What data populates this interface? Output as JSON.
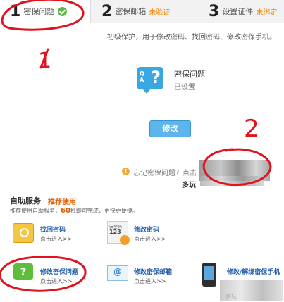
{
  "steps": [
    {
      "num": "1",
      "label": "密保问题",
      "status": ""
    },
    {
      "num": "2",
      "label": "密保邮箱",
      "status": "未验证"
    },
    {
      "num": "3",
      "label": "设置证件",
      "status": "未绑定"
    }
  ],
  "description": "初级保护，用于修改密码、找回密码、修改密保手机。",
  "question_card": {
    "title": "密保问题",
    "status": "已设置",
    "icon": "question-bubble-icon",
    "icon_text": "?"
  },
  "modify_button": "修改",
  "forgot_text": "忘记密保问题？点击",
  "more_text": "多玩",
  "self_service": {
    "title": "自助服务",
    "recommend": "推荐使用",
    "desc_prefix": "推荐使用自助服务，",
    "desc_seconds": "60",
    "desc_suffix": "秒即可完成，更快更便捷。"
  },
  "items": [
    {
      "title": "找回密码",
      "link": "点击进入>>",
      "icon": "folder-search-icon"
    },
    {
      "title": "修改密码",
      "link": "点击进入>>",
      "icon": "password-card-icon",
      "icon_line1": "安全码",
      "icon_line2": "123"
    },
    {
      "title": "修改密保问题",
      "link": "点击进入>>",
      "icon": "question-bubble-green-icon"
    },
    {
      "title": "修改密保邮箱",
      "link": "点击进入>>",
      "icon": "mail-icon"
    },
    {
      "title": "修改/解绑密保手机",
      "link": "",
      "icon": "phone-icon"
    }
  ],
  "bottom_partial_text": "多玩",
  "annotations": {
    "mark1": "1",
    "mark2": "2",
    "color": "#e0141e"
  },
  "colors": {
    "accent_blue": "#39a8e0",
    "button_blue": "#5cb6ec",
    "warn_orange": "#f08200",
    "link_blue": "#1f5ba8",
    "check_green": "#5fb64a"
  }
}
